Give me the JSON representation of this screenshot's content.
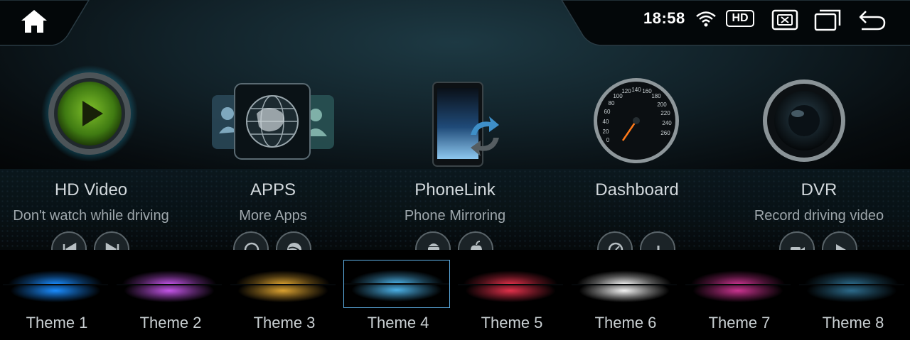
{
  "status_bar": {
    "time": "18:58",
    "hd_label": "HD",
    "icons": [
      "home-icon",
      "wifi-icon",
      "hd-badge",
      "close-window-icon",
      "recent-apps-icon",
      "back-icon"
    ]
  },
  "apps": [
    {
      "id": "hd-video",
      "title": "HD Video",
      "subtitle": "Don't watch while driving",
      "icon": "play-icon",
      "controls": [
        "previous-icon",
        "next-icon"
      ]
    },
    {
      "id": "apps",
      "title": "APPS",
      "subtitle": "More Apps",
      "icon": "globe-icon",
      "controls": [
        "apps-settings-icon",
        "browser-icon"
      ]
    },
    {
      "id": "phonelink",
      "title": "PhoneLink",
      "subtitle": "Phone Mirroring",
      "icon": "phone-sync-icon",
      "controls": [
        "android-icon",
        "apple-icon"
      ]
    },
    {
      "id": "dashboard",
      "title": "Dashboard",
      "subtitle": "",
      "icon": "speedometer-icon",
      "controls": [
        "gauge-icon",
        "equalizer-icon"
      ]
    },
    {
      "id": "dvr",
      "title": "DVR",
      "subtitle": "Record driving video",
      "icon": "camera-lens-icon",
      "controls": [
        "video-camera-icon",
        "play-icon"
      ]
    }
  ],
  "themes": [
    {
      "label": "Theme 1",
      "color": "#1a8cff"
    },
    {
      "label": "Theme 2",
      "color": "#c455e8"
    },
    {
      "label": "Theme 3",
      "color": "#d9a030"
    },
    {
      "label": "Theme 4",
      "color": "#4bb0e6",
      "selected": true
    },
    {
      "label": "Theme 5",
      "color": "#e0304a"
    },
    {
      "label": "Theme 6",
      "color": "#f2f2f2"
    },
    {
      "label": "Theme 7",
      "color": "#c9338f"
    },
    {
      "label": "Theme 8",
      "color": "#2c6a8a"
    }
  ],
  "colors": {
    "selection_border": "#5fb1e8",
    "accent_teal": "#2ad0ff"
  }
}
